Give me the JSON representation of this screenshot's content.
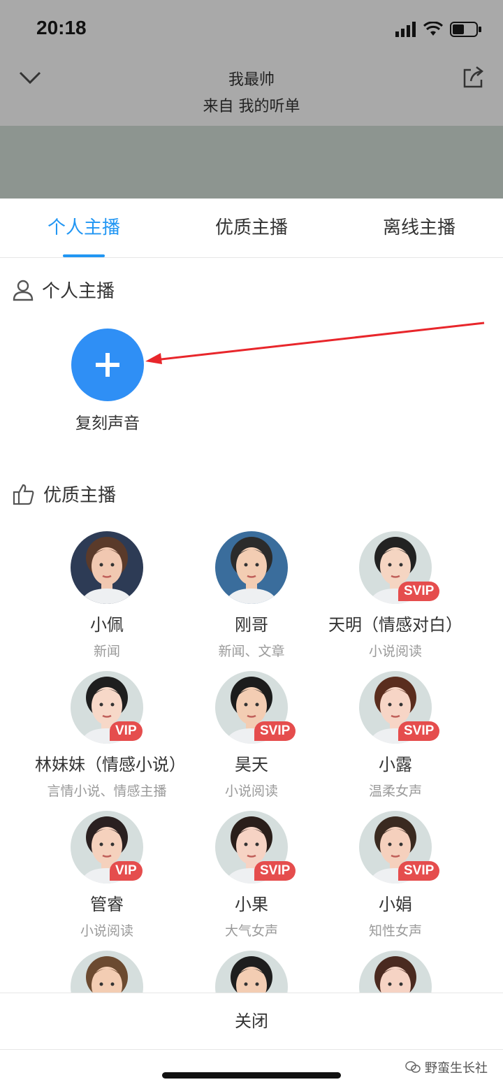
{
  "status": {
    "time": "20:18"
  },
  "header": {
    "title": "我最帅",
    "subtitle": "来自 我的听单"
  },
  "tabs": [
    {
      "label": "个人主播",
      "active": true
    },
    {
      "label": "优质主播",
      "active": false
    },
    {
      "label": "离线主播",
      "active": false
    }
  ],
  "personal": {
    "title": "个人主播",
    "add_label": "复刻声音"
  },
  "premium": {
    "title": "优质主播",
    "anchors": [
      {
        "name": "小佩",
        "tag": "新闻",
        "badge": "",
        "bg": "#2d3b55",
        "skin": "#f1c8b1",
        "hair": "#5a3a2a"
      },
      {
        "name": "刚哥",
        "tag": "新闻、文章",
        "badge": "",
        "bg": "#3a6d9c",
        "skin": "#f3cdb3",
        "hair": "#2b2b2b"
      },
      {
        "name": "天明（情感对白）",
        "tag": "小说阅读",
        "badge": "SVIP",
        "bg": "#d5dedd",
        "skin": "#f5d5c2",
        "hair": "#222222"
      },
      {
        "name": "林妹妹（情感小说）",
        "tag": "言情小说、情感主播",
        "badge": "VIP",
        "bg": "#d5dedd",
        "skin": "#f7d8c8",
        "hair": "#1e1e1e"
      },
      {
        "name": "昊天",
        "tag": "小说阅读",
        "badge": "SVIP",
        "bg": "#d5dedd",
        "skin": "#f3cdb3",
        "hair": "#1c1c1c"
      },
      {
        "name": "小露",
        "tag": "温柔女声",
        "badge": "SVIP",
        "bg": "#d5dedd",
        "skin": "#f7d5c6",
        "hair": "#5a2d1e"
      },
      {
        "name": "管睿",
        "tag": "小说阅读",
        "badge": "VIP",
        "bg": "#d5dedd",
        "skin": "#f5d1bd",
        "hair": "#2a2020"
      },
      {
        "name": "小果",
        "tag": "大气女声",
        "badge": "SVIP",
        "bg": "#d5dedd",
        "skin": "#f6d3c4",
        "hair": "#2a1e1a"
      },
      {
        "name": "小娟",
        "tag": "知性女声",
        "badge": "SVIP",
        "bg": "#d5dedd",
        "skin": "#f5d0bd",
        "hair": "#3a2a20"
      },
      {
        "name": "",
        "tag": "",
        "badge": "",
        "bg": "#d5dedd",
        "skin": "#f3cdb3",
        "hair": "#6b4a30"
      },
      {
        "name": "",
        "tag": "",
        "badge": "",
        "bg": "#d5dedd",
        "skin": "#f3cdb3",
        "hair": "#1e1e1e"
      },
      {
        "name": "",
        "tag": "",
        "badge": "",
        "bg": "#d5dedd",
        "skin": "#f6d3c4",
        "hair": "#4a2a20"
      }
    ]
  },
  "footer": {
    "close_label": "关闭"
  },
  "watermark": "野蛮生长社",
  "colors": {
    "accent": "#2196f3",
    "badge": "#e54d4d"
  }
}
